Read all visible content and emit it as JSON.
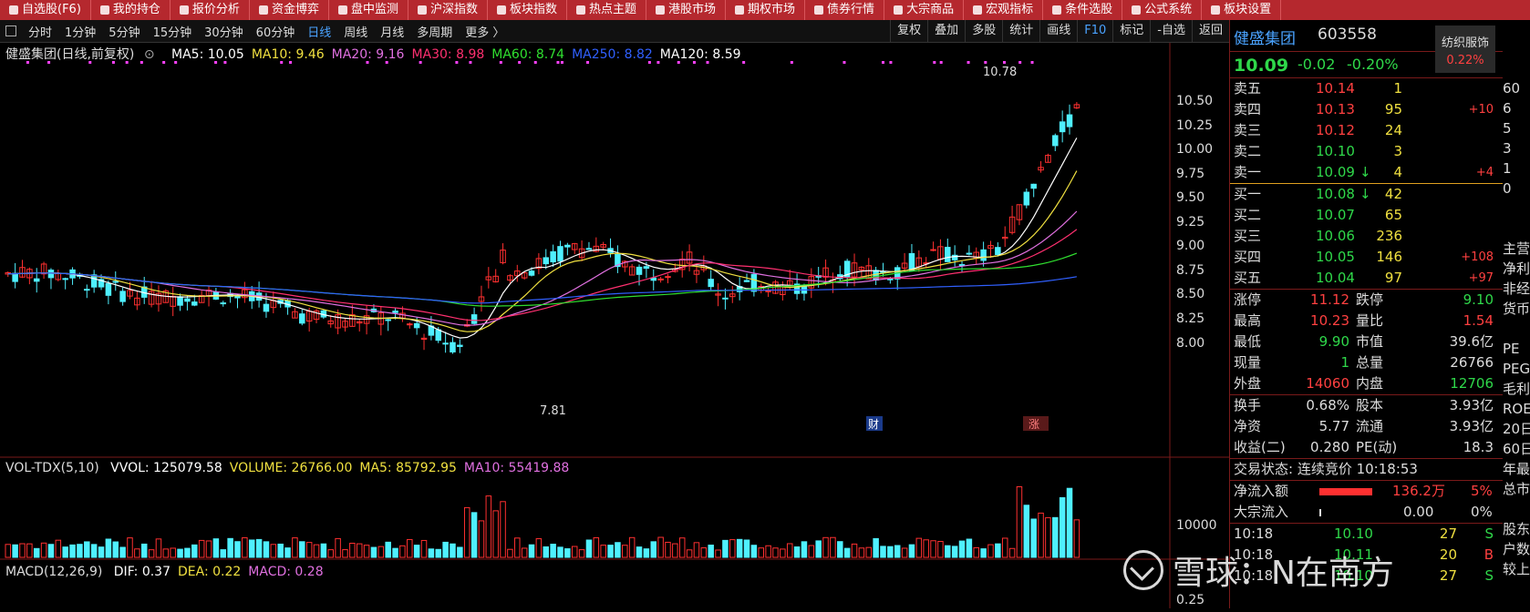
{
  "top_menu": [
    "自选股(F6)",
    "我的持仓",
    "报价分析",
    "资金博弈",
    "盘中监测",
    "沪深指数",
    "板块指数",
    "热点主题",
    "港股市场",
    "期权市场",
    "债券行情",
    "大宗商品",
    "宏观指标",
    "条件选股",
    "公式系统",
    "板块设置"
  ],
  "periods": [
    "分时",
    "1分钟",
    "5分钟",
    "15分钟",
    "30分钟",
    "60分钟",
    "日线",
    "周线",
    "月线",
    "多周期",
    "更多 〉"
  ],
  "active_period": "日线",
  "toolbar_right": [
    "复权",
    "叠加",
    "多股",
    "统计",
    "画线",
    "F10",
    "标记",
    "-自选",
    "返回"
  ],
  "title_line": {
    "name": "健盛集团(日线,前复权)",
    "ma": [
      {
        "text": "MA5: 10.05",
        "color": "#ffffff"
      },
      {
        "text": "MA10: 9.46",
        "color": "#f0e040"
      },
      {
        "text": "MA20: 9.16",
        "color": "#e070e0"
      },
      {
        "text": "MA30: 8.98",
        "color": "#ff3070"
      },
      {
        "text": "MA60: 8.74",
        "color": "#30e030"
      },
      {
        "text": "MA250: 8.82",
        "color": "#3060ff"
      },
      {
        "text": "MA120: 8.59",
        "color": "#ffffff"
      }
    ]
  },
  "price_axis": [
    "10.50",
    "10.25",
    "10.00",
    "9.75",
    "9.50",
    "9.25",
    "9.00",
    "8.75",
    "8.50",
    "8.25",
    "8.00"
  ],
  "annotations": {
    "high": "10.78",
    "low": "7.81",
    "cai": "财",
    "zhang": "涨"
  },
  "vol_line": {
    "name": "VOL-TDX(5,10)",
    "items": [
      {
        "text": "VVOL: 125079.58",
        "color": "#ffffff"
      },
      {
        "text": "VOLUME: 26766.00",
        "color": "#f0e040"
      },
      {
        "text": "MA5: 85792.95",
        "color": "#f0e040"
      },
      {
        "text": "MA10: 55419.88",
        "color": "#e070e0"
      }
    ],
    "axis": "10000"
  },
  "macd_line": {
    "name": "MACD(12,26,9)",
    "items": [
      {
        "text": "DIF: 0.37",
        "color": "#ffffff"
      },
      {
        "text": "DEA: 0.22",
        "color": "#f0e040"
      },
      {
        "text": "MACD: 0.28",
        "color": "#e070e0"
      }
    ],
    "axis": "0.25"
  },
  "quote": {
    "name": "健盛集团",
    "code": "603558",
    "sector": "纺织服饰",
    "sector_pct": "0.22%",
    "price": "10.09",
    "change": "-0.02",
    "change_pct": "-0.20%",
    "asks": [
      {
        "label": "卖五",
        "price": "10.14",
        "vol": "1",
        "chg": ""
      },
      {
        "label": "卖四",
        "price": "10.13",
        "vol": "95",
        "chg": "+10"
      },
      {
        "label": "卖三",
        "price": "10.12",
        "vol": "24",
        "chg": ""
      },
      {
        "label": "卖二",
        "price": "10.10",
        "vol": "3",
        "chg": ""
      },
      {
        "label": "卖一",
        "price": "10.09",
        "vol": "4",
        "chg": "+4",
        "arrow": "↓"
      }
    ],
    "bids": [
      {
        "label": "买一",
        "price": "10.08",
        "vol": "42",
        "chg": "",
        "arrow": "↓"
      },
      {
        "label": "买二",
        "price": "10.07",
        "vol": "65",
        "chg": ""
      },
      {
        "label": "买三",
        "price": "10.06",
        "vol": "236",
        "chg": ""
      },
      {
        "label": "买四",
        "price": "10.05",
        "vol": "146",
        "chg": "+108"
      },
      {
        "label": "买五",
        "price": "10.04",
        "vol": "97",
        "chg": "+97"
      }
    ],
    "stats": [
      {
        "l1": "涨停",
        "v1": "11.12",
        "c1": "red",
        "l2": "跌停",
        "v2": "9.10",
        "c2": "green"
      },
      {
        "l1": "最高",
        "v1": "10.23",
        "c1": "red",
        "l2": "量比",
        "v2": "1.54",
        "c2": "red"
      },
      {
        "l1": "最低",
        "v1": "9.90",
        "c1": "green",
        "l2": "市值",
        "v2": "39.6亿",
        "c2": "white"
      },
      {
        "l1": "现量",
        "v1": "1",
        "c1": "green",
        "l2": "总量",
        "v2": "26766",
        "c2": "white"
      },
      {
        "l1": "外盘",
        "v1": "14060",
        "c1": "red",
        "l2": "内盘",
        "v2": "12706",
        "c2": "green"
      }
    ],
    "stats2": [
      {
        "l1": "换手",
        "v1": "0.68%",
        "l2": "股本",
        "v2": "3.93亿"
      },
      {
        "l1": "净资",
        "v1": "5.77",
        "l2": "流通",
        "v2": "3.93亿"
      },
      {
        "l1": "收益(二)",
        "v1": "0.280",
        "l2": "PE(动)",
        "v2": "18.3"
      }
    ],
    "trade_status": "交易状态: 连续竞价 10:18:53",
    "netflow": {
      "label": "净流入额",
      "value": "136.2万",
      "pct": "5%"
    },
    "bigflow": {
      "label": "大宗流入",
      "value": "0.00",
      "pct": "0%"
    },
    "ticks": [
      {
        "time": "10:18",
        "price": "10.10",
        "vol": "27",
        "side": "S"
      },
      {
        "time": "10:18",
        "price": "10.11",
        "vol": "20",
        "side": "B"
      },
      {
        "time": "10:18",
        "price": "10.10",
        "vol": "27",
        "side": "S"
      }
    ]
  },
  "edge_text": [
    "60",
    "6",
    "5",
    "3",
    "1",
    "0",
    "",
    "",
    "主营",
    "净利",
    "非经",
    "货币",
    "",
    "PE",
    "PEG",
    "毛利",
    "ROE",
    "20日",
    "60日",
    "年最",
    "总市",
    "",
    "股东",
    "户数",
    "较上"
  ],
  "watermark": "雪球：N在南方"
}
